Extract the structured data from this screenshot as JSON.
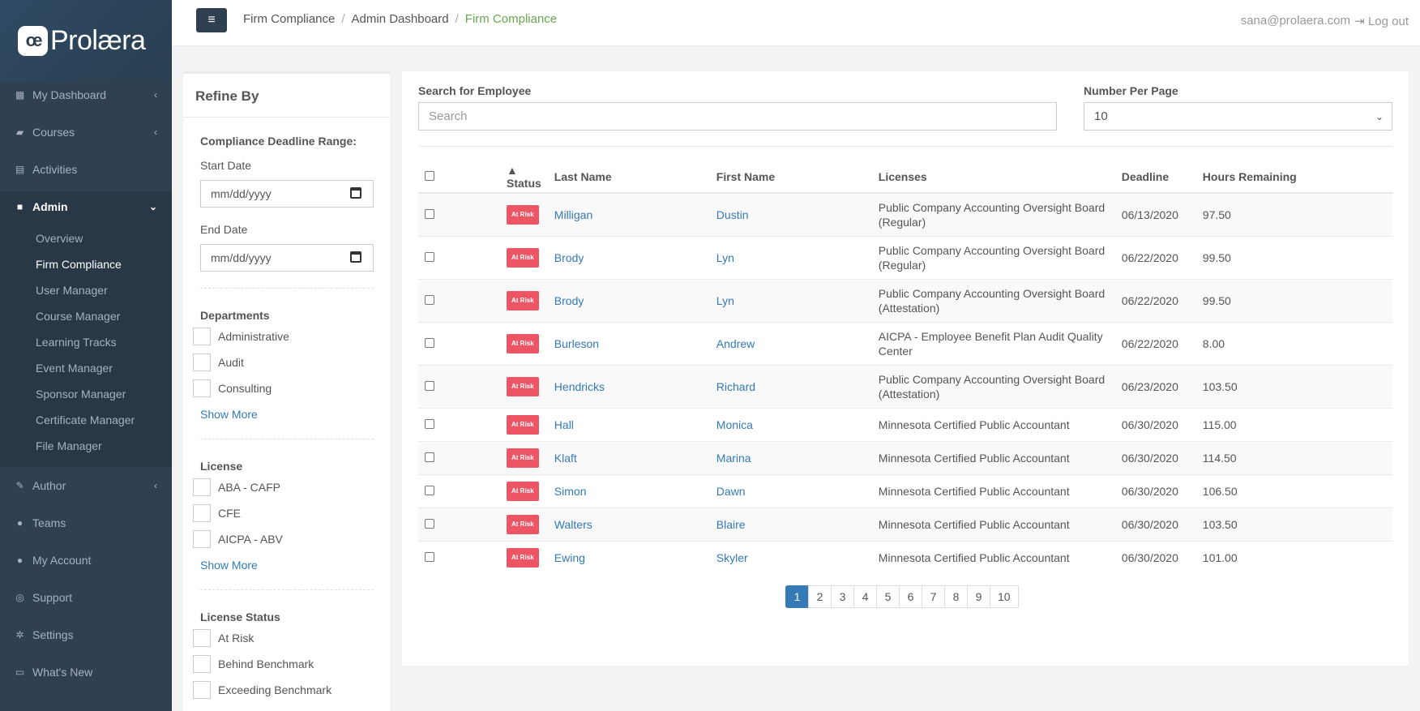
{
  "brand": {
    "logo_mark": "œ",
    "name": "Prolæra"
  },
  "sidebar": {
    "items": [
      {
        "label": "My Dashboard",
        "icon": "grid-icon"
      },
      {
        "label": "Courses",
        "icon": "book-icon"
      },
      {
        "label": "Activities",
        "icon": "document-icon"
      },
      {
        "label": "Admin",
        "icon": "briefcase-icon"
      },
      {
        "label": "Author",
        "icon": "edit-icon"
      },
      {
        "label": "Teams",
        "icon": "users-icon"
      },
      {
        "label": "My Account",
        "icon": "user-icon"
      },
      {
        "label": "Support",
        "icon": "globe-icon"
      },
      {
        "label": "Settings",
        "icon": "gear-icon"
      },
      {
        "label": "What's New",
        "icon": "news-icon"
      }
    ],
    "admin_sub": [
      "Overview",
      "Firm Compliance",
      "User Manager",
      "Course Manager",
      "Learning Tracks",
      "Event Manager",
      "Sponsor Manager",
      "Certificate Manager",
      "File Manager"
    ]
  },
  "topbar": {
    "breadcrumbs": [
      "Firm Compliance",
      "Admin Dashboard",
      "Firm Compliance"
    ],
    "user_email": "sana@prolaera.com",
    "logout_label": "Log out"
  },
  "refine": {
    "title": "Refine By",
    "deadline_label": "Compliance Deadline Range:",
    "start_label": "Start Date",
    "end_label": "End Date",
    "date_placeholder": "mm/dd/yyyy",
    "departments_label": "Departments",
    "departments": [
      "Administrative",
      "Audit",
      "Consulting"
    ],
    "license_label": "License",
    "licenses": [
      "ABA - CAFP",
      "CFE",
      "AICPA - ABV"
    ],
    "license_status_label": "License Status",
    "license_statuses": [
      "At Risk",
      "Behind Benchmark",
      "Exceeding Benchmark"
    ],
    "show_more": "Show More"
  },
  "main": {
    "search_label": "Search for Employee",
    "search_placeholder": "Search",
    "per_page_label": "Number Per Page",
    "per_page_value": "10",
    "columns": [
      "▲ Status",
      "Last Name",
      "First Name",
      "Licenses",
      "Deadline",
      "Hours Remaining"
    ],
    "rows": [
      {
        "status": "At Risk",
        "last": "Milligan",
        "first": "Dustin",
        "license": "Public Company Accounting Oversight Board (Regular)",
        "deadline": "06/13/2020",
        "hours": "97.50"
      },
      {
        "status": "At Risk",
        "last": "Brody",
        "first": "Lyn",
        "license": "Public Company Accounting Oversight Board (Regular)",
        "deadline": "06/22/2020",
        "hours": "99.50"
      },
      {
        "status": "At Risk",
        "last": "Brody",
        "first": "Lyn",
        "license": "Public Company Accounting Oversight Board (Attestation)",
        "deadline": "06/22/2020",
        "hours": "99.50"
      },
      {
        "status": "At Risk",
        "last": "Burleson",
        "first": "Andrew",
        "license": "AICPA - Employee Benefit Plan Audit Quality Center",
        "deadline": "06/22/2020",
        "hours": "8.00"
      },
      {
        "status": "At Risk",
        "last": "Hendricks",
        "first": "Richard",
        "license": "Public Company Accounting Oversight Board (Attestation)",
        "deadline": "06/23/2020",
        "hours": "103.50"
      },
      {
        "status": "At Risk",
        "last": "Hall",
        "first": "Monica",
        "license": "Minnesota Certified Public Accountant",
        "deadline": "06/30/2020",
        "hours": "115.00"
      },
      {
        "status": "At Risk",
        "last": "Klaft",
        "first": "Marina",
        "license": "Minnesota Certified Public Accountant",
        "deadline": "06/30/2020",
        "hours": "114.50"
      },
      {
        "status": "At Risk",
        "last": "Simon",
        "first": "Dawn",
        "license": "Minnesota Certified Public Accountant",
        "deadline": "06/30/2020",
        "hours": "106.50"
      },
      {
        "status": "At Risk",
        "last": "Walters",
        "first": "Blaire",
        "license": "Minnesota Certified Public Accountant",
        "deadline": "06/30/2020",
        "hours": "103.50"
      },
      {
        "status": "At Risk",
        "last": "Ewing",
        "first": "Skyler",
        "license": "Minnesota Certified Public Accountant",
        "deadline": "06/30/2020",
        "hours": "101.00"
      }
    ],
    "pages": [
      "1",
      "2",
      "3",
      "4",
      "5",
      "6",
      "7",
      "8",
      "9",
      "10"
    ]
  },
  "colors": {
    "sidebar": "#2f4050",
    "accent": "#337ab7",
    "danger": "#ed5565",
    "breadcrumb_current": "#6aa84f"
  }
}
